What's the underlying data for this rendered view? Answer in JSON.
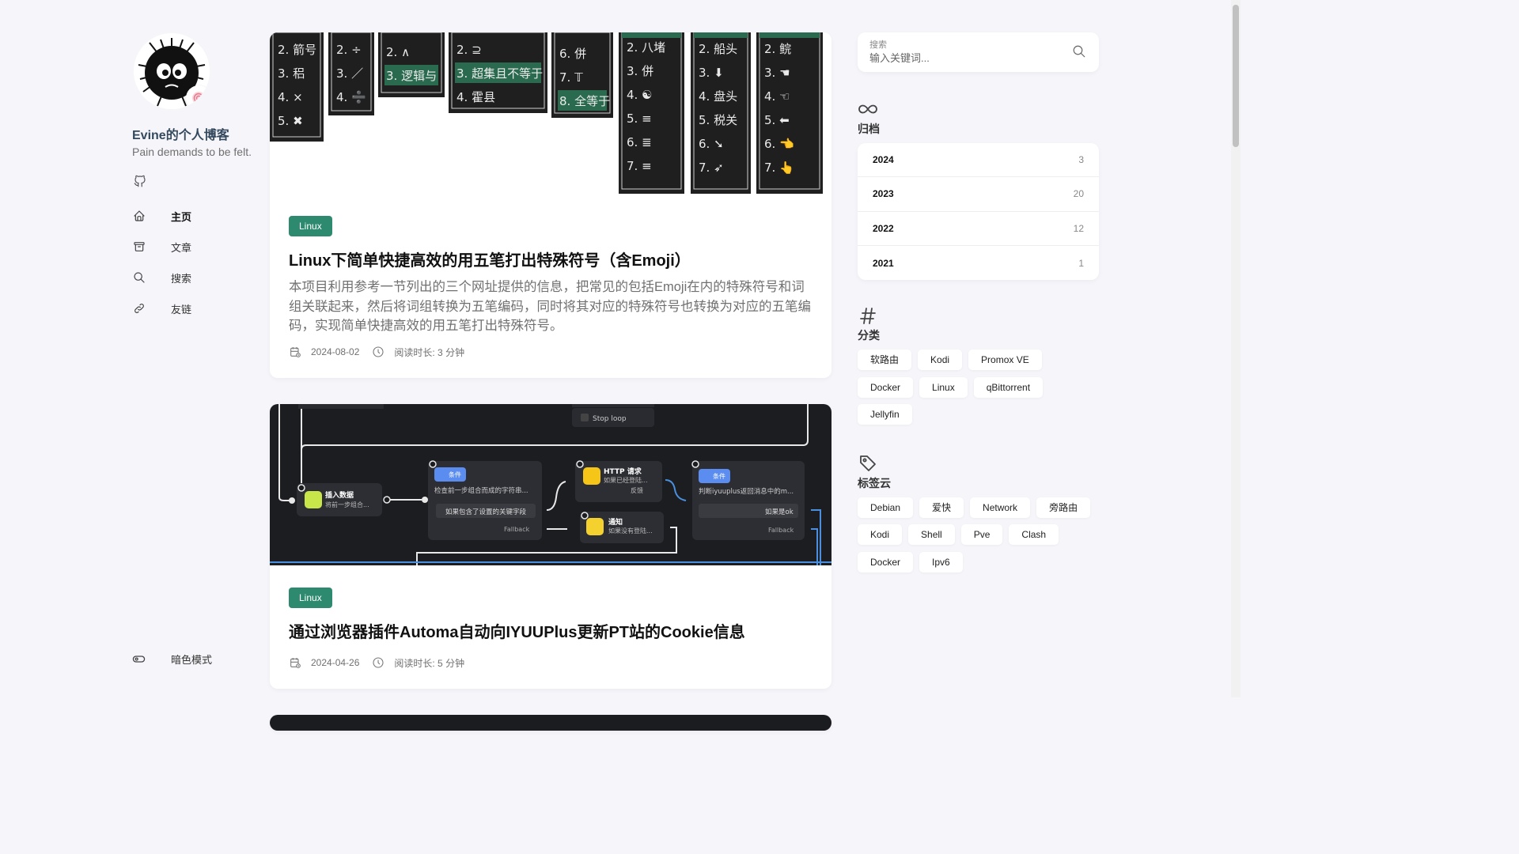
{
  "site": {
    "title": "Evine的个人博客",
    "description": "Pain demands to be felt."
  },
  "nav": [
    {
      "label": "主页",
      "icon": "home-icon",
      "active": true
    },
    {
      "label": "文章",
      "icon": "archive-box-icon"
    },
    {
      "label": "搜索",
      "icon": "search-icon"
    },
    {
      "label": "友链",
      "icon": "link-icon"
    }
  ],
  "dark_mode_label": "暗色模式",
  "posts": [
    {
      "tag": "Linux",
      "title": "Linux下简单快捷高效的用五笔打出特殊符号（含Emoji）",
      "excerpt": "本项目利用参考一节列出的三个网址提供的信息，把常见的包括Emoji在内的特殊符号和词组关联起来，然后将词组转换为五笔编码，同时将其对应的特殊符号也转换为对应的五笔编码，实现简单快捷高效的用五笔打出特殊符号。",
      "date": "2024-08-02",
      "reading_time": "阅读时长: 3 分钟",
      "cover_candidates": [
        [
          "2. 箭号",
          "3. 稆",
          "4. ×",
          "5. ✖"
        ],
        [
          "2. ÷",
          "3. ／",
          "4. ➗"
        ],
        [
          "2. ∧",
          "3. 逻辑与"
        ],
        [
          "2. ⊇",
          "3. 超集且不等于",
          "4. 霍县"
        ],
        [
          "6. 併",
          "7. 𝕋",
          "8. 全等于"
        ],
        [
          "2. 八堵",
          "3. 併",
          "4. ☯",
          "5. ≡",
          "6. ≣",
          "7. ≡"
        ],
        [
          "2. 船头",
          "3. ⬇",
          "4. 盘头",
          "5. 税关",
          "6. ➘",
          "7. ➶"
        ],
        [
          "2. 鲩",
          "3. ☚",
          "4. ☜",
          "5. ⬅",
          "6. 👈",
          "7. 👆"
        ]
      ]
    },
    {
      "tag": "Linux",
      "title": "通过浏览器插件Automa自动向IYUUPlus更新PT站的Cookie信息",
      "date": "2024-04-26",
      "reading_time": "阅读时长: 5 分钟",
      "cover_nodes": {
        "stop_loop": "Stop loop",
        "insert_title": "插入数据",
        "insert_desc": "将前一步组合...",
        "cond1_tag": "条件",
        "cond1_desc": "检查前一步组合而成的字符串...",
        "cond1_rule": "如果包含了设置的关键字段",
        "fallback": "Fallback",
        "http_title": "HTTP 请求",
        "http_desc": "如果已经登陆...",
        "feedback": "反馈",
        "notify_title": "通知",
        "notify_desc": "如果没有登陆...",
        "cond2_tag": "条件",
        "cond2_desc": "判断iyuuplus返回消息中的m...",
        "cond2_rule": "如果是ok"
      }
    }
  ],
  "search": {
    "label": "搜索",
    "placeholder": "输入关键词..."
  },
  "archives": {
    "title": "归档",
    "items": [
      {
        "year": "2024",
        "count": "3"
      },
      {
        "year": "2023",
        "count": "20"
      },
      {
        "year": "2022",
        "count": "12"
      },
      {
        "year": "2021",
        "count": "1"
      }
    ]
  },
  "categories": {
    "title": "分类",
    "items": [
      "软路由",
      "Kodi",
      "Promox VE",
      "Docker",
      "Linux",
      "qBittorrent",
      "Jellyfin"
    ]
  },
  "tags": {
    "title": "标签云",
    "items": [
      "Debian",
      "爱快",
      "Network",
      "旁路由",
      "Kodi",
      "Shell",
      "Pve",
      "Clash",
      "Docker",
      "Ipv6"
    ]
  },
  "colors": {
    "tag_bg": "#2d8a6e",
    "page_bg": "#f5f5fa",
    "title_color": "#34495e"
  }
}
